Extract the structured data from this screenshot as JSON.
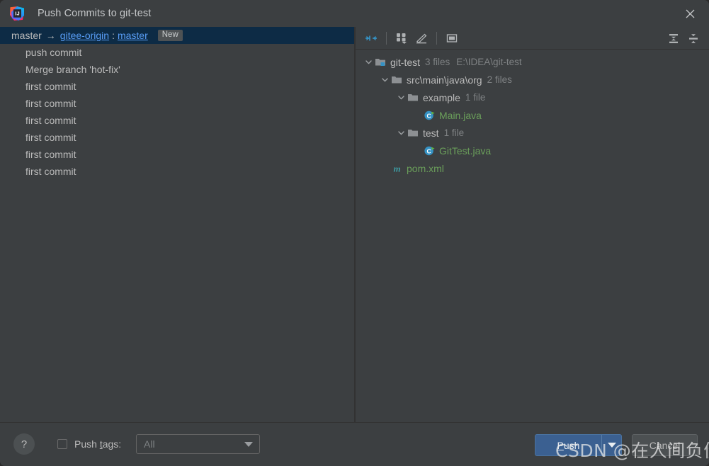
{
  "window": {
    "title": "Push Commits to git-test",
    "app_icon": "intellij-idea-logo",
    "close_icon": "close-icon"
  },
  "left_panel": {
    "branch_row": {
      "local_branch": "master",
      "arrow": "→",
      "remote": "gitee-origin",
      "separator": ":",
      "remote_branch": "master",
      "badge": "New"
    },
    "commits": [
      {
        "message": "push commit"
      },
      {
        "message": "Merge branch 'hot-fix'"
      },
      {
        "message": "first commit"
      },
      {
        "message": "first commit"
      },
      {
        "message": "first commit"
      },
      {
        "message": "first commit"
      },
      {
        "message": "first commit"
      },
      {
        "message": "first commit"
      }
    ]
  },
  "right_panel": {
    "toolbar": {
      "buttons": [
        {
          "name": "collapse-selection-icon",
          "tooltip": "Collapse"
        },
        {
          "name": "group-by-icon",
          "tooltip": "Group By"
        },
        {
          "name": "edit-icon",
          "tooltip": "Edit"
        },
        {
          "name": "preview-diff-icon",
          "tooltip": "Preview Diff"
        },
        {
          "name": "expand-all-icon",
          "tooltip": "Expand All"
        },
        {
          "name": "collapse-all-icon",
          "tooltip": "Collapse All"
        }
      ]
    },
    "tree": [
      {
        "id": "root",
        "depth": 0,
        "twisty": "expanded",
        "icon": "module-folder-icon",
        "label": "git-test",
        "count": "3 files",
        "path": "E:\\IDEA\\git-test",
        "kind": "folder"
      },
      {
        "id": "src",
        "depth": 1,
        "twisty": "expanded",
        "icon": "folder-icon",
        "label": "src\\main\\java\\org",
        "count": "2 files",
        "path": "",
        "kind": "folder"
      },
      {
        "id": "example",
        "depth": 2,
        "twisty": "expanded",
        "icon": "folder-icon",
        "label": "example",
        "count": "1 file",
        "path": "",
        "kind": "folder"
      },
      {
        "id": "main-java",
        "depth": 3,
        "twisty": "none",
        "icon": "java-class-icon",
        "label": "Main.java",
        "count": "",
        "path": "",
        "kind": "file"
      },
      {
        "id": "test",
        "depth": 2,
        "twisty": "expanded",
        "icon": "folder-icon",
        "label": "test",
        "count": "1 file",
        "path": "",
        "kind": "folder"
      },
      {
        "id": "gittest-java",
        "depth": 3,
        "twisty": "none",
        "icon": "java-class-icon",
        "label": "GitTest.java",
        "count": "",
        "path": "",
        "kind": "file"
      },
      {
        "id": "pom-xml",
        "depth": 1,
        "twisty": "none",
        "icon": "maven-icon",
        "label": "pom.xml",
        "count": "",
        "path": "",
        "kind": "file"
      }
    ]
  },
  "bottom_bar": {
    "help_label": "?",
    "push_tags_checked": false,
    "push_tags_label_pre": "Push ",
    "push_tags_label_accel": "t",
    "push_tags_label_post": "ags:",
    "push_tags_value": "All",
    "push_tags_options": [
      "All"
    ],
    "push_button_pre": "",
    "push_button_accel": "P",
    "push_button_post": "ush",
    "cancel_button": "Cancel"
  },
  "watermark": {
    "text": "CSDN @在人间负债^"
  },
  "colors": {
    "dialog_bg": "#3c3f41",
    "selected_row_bg": "#0d2b45",
    "link": "#589df6",
    "text": "#bbbbbb",
    "muted_text": "#7e8183",
    "file_green": "#6a9e5a",
    "accent_blue": "#3b6091",
    "maven_teal": "#3d9aa1"
  }
}
